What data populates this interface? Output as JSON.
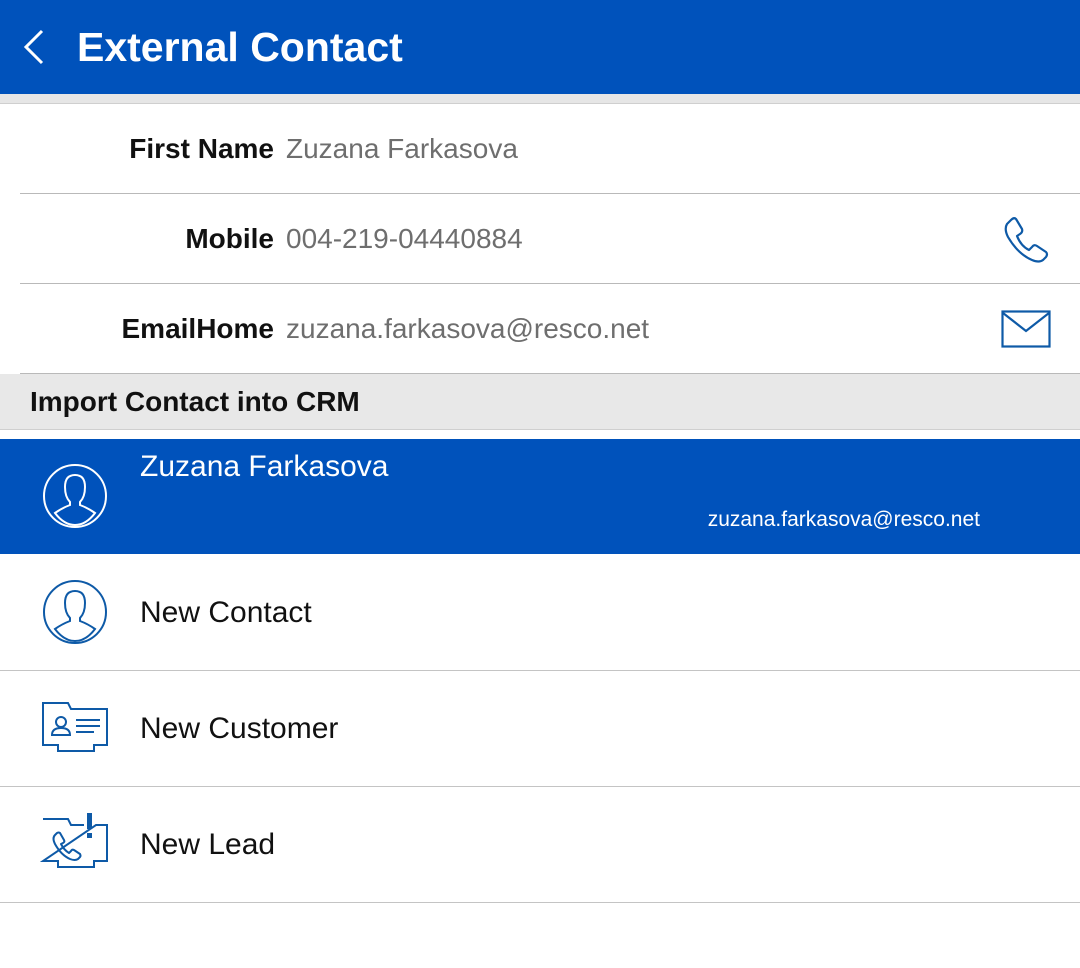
{
  "header": {
    "title": "External Contact",
    "icons": {
      "back": "chevron-left-icon"
    }
  },
  "fields": [
    {
      "label": "First Name",
      "value": "Zuzana Farkasova"
    },
    {
      "label": "Mobile",
      "value": "004-219-04440884",
      "action_icon": "phone-icon"
    },
    {
      "label": "EmailHome",
      "value": "zuzana.farkasova@resco.net",
      "action_icon": "mail-icon"
    }
  ],
  "import_section": {
    "title": "Import Contact into CRM",
    "selected": {
      "name": "Zuzana Farkasova",
      "email": "zuzana.farkasova@resco.net",
      "icon": "contact-avatar-icon"
    },
    "actions": [
      {
        "label": "New Contact",
        "icon": "contact-avatar-icon"
      },
      {
        "label": "New Customer",
        "icon": "business-card-icon"
      },
      {
        "label": "New Lead",
        "icon": "lead-phone-icon"
      }
    ]
  },
  "colors": {
    "brand": "#0052BB",
    "icon_stroke": "#0E5AA7",
    "section_bg": "#E8E8E8",
    "value_text": "#6E6E6E"
  }
}
